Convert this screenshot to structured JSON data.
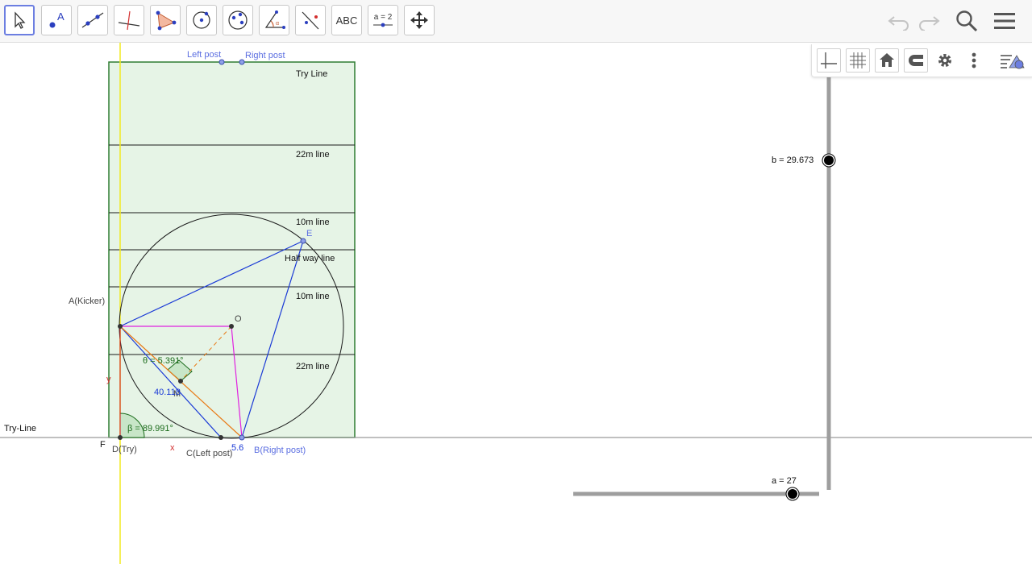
{
  "toolbar": {
    "tools": [
      "move-tool",
      "point-tool",
      "line-tool",
      "perpendicular-line-tool",
      "polygon-tool",
      "circle-center-point-tool",
      "ellipse-tool",
      "angle-tool",
      "reflect-tool",
      "text-tool",
      "slider-tool",
      "move-graphics-view-tool"
    ],
    "text_tool_label": "ABC",
    "slider_tool_label": "a = 2",
    "actions": [
      "undo-icon",
      "redo-icon",
      "search-icon",
      "menu-icon"
    ]
  },
  "style_bar": {
    "buttons": [
      "axes-icon",
      "grid-icon",
      "home-icon",
      "magnet-icon",
      "gear-icon",
      "more-vert-icon",
      "algebra-toggle-icon"
    ]
  },
  "colors": {
    "field_fill": "#e6f4e6",
    "field_border": "#2e7d32",
    "point_blue": "#5b6ee1",
    "line_blue": "#1a3ad6",
    "magenta": "#e020e0",
    "orange": "#e87a16",
    "yellow": "#f2ea20",
    "red": "#d32f2f",
    "angle_green": "#1b6b1b",
    "slider_gray": "#9e9e9e"
  },
  "pitch": {
    "left_post": "Left post",
    "right_post": "Right post",
    "lines": [
      "Try Line",
      "22m line",
      "10m line",
      "Half way line",
      "10m line",
      "22m line"
    ]
  },
  "points": {
    "A": "A(Kicker)",
    "O": "O",
    "E": "E",
    "M": "M",
    "D": "D(Try)",
    "C": "C(Left post)",
    "B": "B(Right post)",
    "F": "F",
    "x": "x",
    "y": "y"
  },
  "measurements": {
    "theta": "θ = 5.391°",
    "beta": "β = 89.991°",
    "distance": "40.118",
    "post_gap": "5.6"
  },
  "axis_label": "Try-Line",
  "sliders": {
    "a": {
      "label": "a = 27",
      "value": 27
    },
    "b": {
      "label": "b = 29.673",
      "value": 29.673
    }
  }
}
